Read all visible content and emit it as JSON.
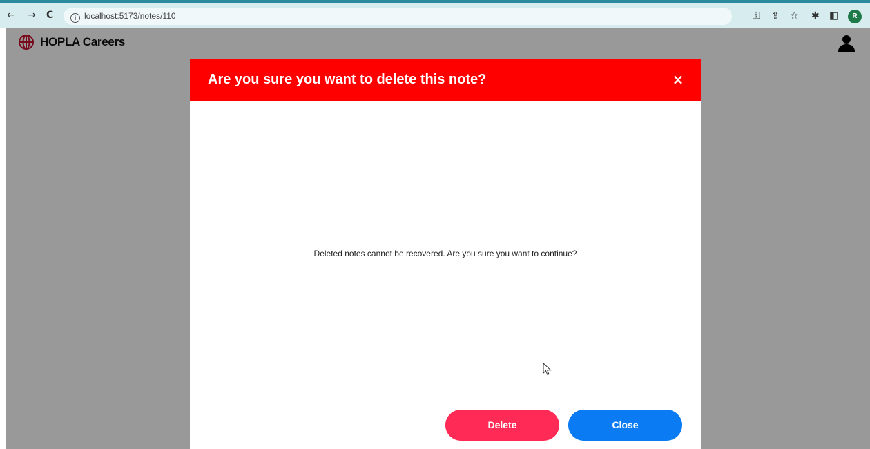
{
  "browser": {
    "back_icon": "←",
    "forward_icon": "→",
    "reload_icon": "C",
    "info_icon": "i",
    "url": "localhost:5173/notes/110",
    "profile_initial": "R"
  },
  "app": {
    "brand_title": "HOPLA Careers",
    "brand_color": "#c8102e"
  },
  "modal": {
    "title": "Are you sure you want to delete this note?",
    "close_icon": "×",
    "message": "Deleted notes cannot be recovered. Are you sure you want to continue?",
    "delete_label": "Delete",
    "close_label": "Close",
    "header_color": "#ff0000",
    "delete_color": "#ff2a55",
    "close_color": "#0a7bf3"
  }
}
